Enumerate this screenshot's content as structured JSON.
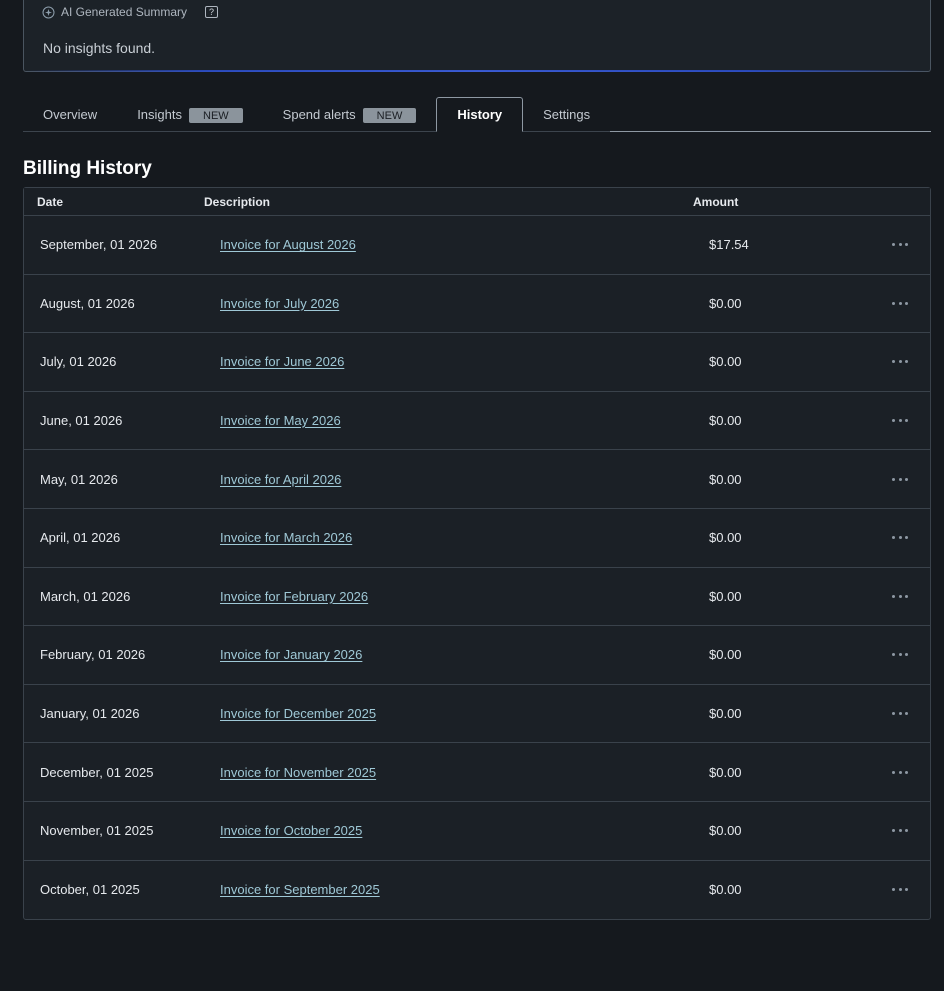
{
  "summary": {
    "title": "AI Generated Summary",
    "help_glyph": "?",
    "body": "No insights found.",
    "icon": "sparkle-icon"
  },
  "tabs": [
    {
      "label": "Overview",
      "badge": ""
    },
    {
      "label": "Insights",
      "badge": "NEW"
    },
    {
      "label": "Spend alerts",
      "badge": "NEW"
    },
    {
      "label": "History",
      "badge": "",
      "active": true
    },
    {
      "label": "Settings",
      "badge": ""
    }
  ],
  "billing": {
    "title": "Billing History",
    "columns": {
      "date": "Date",
      "description": "Description",
      "amount": "Amount"
    },
    "rows": [
      {
        "date": "September, 01 2026",
        "description": "Invoice for August 2026",
        "amount": "$17.54"
      },
      {
        "date": "August, 01 2026",
        "description": "Invoice for July 2026",
        "amount": "$0.00"
      },
      {
        "date": "July, 01 2026",
        "description": "Invoice for June 2026",
        "amount": "$0.00"
      },
      {
        "date": "June, 01 2026",
        "description": "Invoice for May 2026",
        "amount": "$0.00"
      },
      {
        "date": "May, 01 2026",
        "description": "Invoice for April 2026",
        "amount": "$0.00"
      },
      {
        "date": "April, 01 2026",
        "description": "Invoice for March 2026",
        "amount": "$0.00"
      },
      {
        "date": "March, 01 2026",
        "description": "Invoice for February 2026",
        "amount": "$0.00"
      },
      {
        "date": "February, 01 2026",
        "description": "Invoice for January 2026",
        "amount": "$0.00"
      },
      {
        "date": "January, 01 2026",
        "description": "Invoice for December 2025",
        "amount": "$0.00"
      },
      {
        "date": "December, 01 2025",
        "description": "Invoice for November 2025",
        "amount": "$0.00"
      },
      {
        "date": "November, 01 2025",
        "description": "Invoice for October 2025",
        "amount": "$0.00"
      },
      {
        "date": "October, 01 2025",
        "description": "Invoice for September 2025",
        "amount": "$0.00"
      }
    ]
  },
  "colors": {
    "background": "#15191e",
    "link": "#9fc8d6",
    "badge": "#8b949c",
    "accent_glow": "#3a5de0"
  }
}
